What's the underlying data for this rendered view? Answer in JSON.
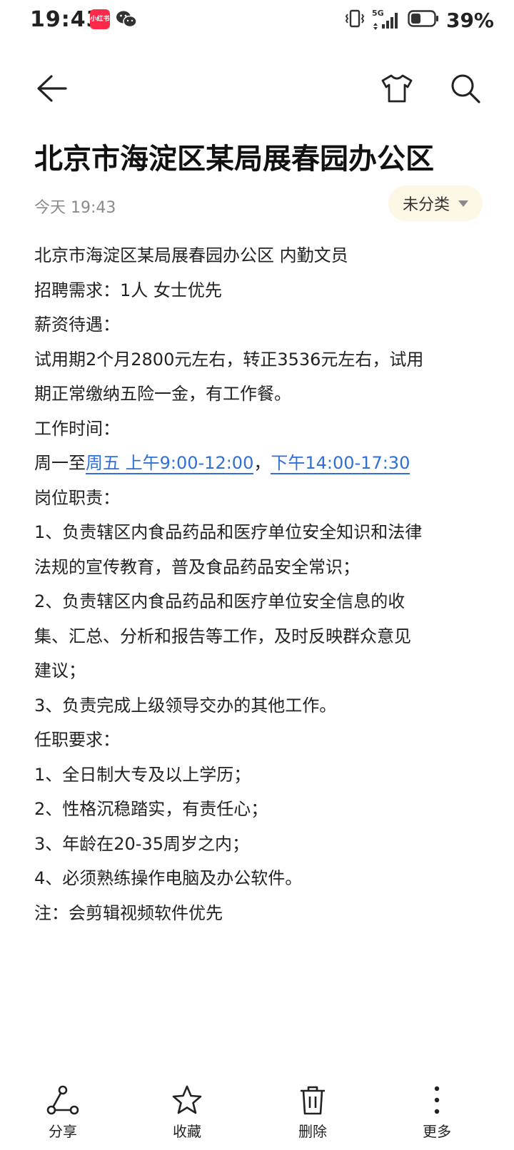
{
  "status_bar": {
    "time": "19:43",
    "app_badge": "小红书",
    "network": "5G",
    "battery": "39%"
  },
  "toolbar": {
    "back_icon": "arrow-left-icon",
    "theme_icon": "tshirt-icon",
    "search_icon": "search-icon"
  },
  "note": {
    "title": "北京市海淀区某局展春园办公区",
    "date": "今天 19:43",
    "category": "未分类",
    "lines": {
      "l1": "北京市海淀区某局展春园办公区  内勤文员",
      "l2": "招聘需求：1人   女士优先",
      "l3": "薪资待遇：",
      "l4": "试用期2个月2800元左右，转正3536元左右，试用",
      "l5": "期正常缴纳五险一金，有工作餐。",
      "l6": "工作时间：",
      "l7_prefix": "周一至",
      "l7_link1": "周五 上午9:00-12:00",
      "l7_sep": "，",
      "l7_link2": "下午14:00-17:30",
      "l8": "岗位职责：",
      "l9": "1、负责辖区内食品药品和医疗单位安全知识和法律",
      "l10": "法规的宣传教育，普及食品药品安全常识；",
      "l11": "2、负责辖区内食品药品和医疗单位安全信息的收",
      "l12": "集、汇总、分析和报告等工作，及时反映群众意见",
      "l13": "建议；",
      "l14": "3、负责完成上级领导交办的其他工作。",
      "l15": "任职要求：",
      "l16": "1、全日制大专及以上学历；",
      "l17": "2、性格沉稳踏实，有责任心；",
      "l18": "3、年龄在20-35周岁之内；",
      "l19": "4、必须熟练操作电脑及办公软件。",
      "l20": "注：会剪辑视频软件优先"
    }
  },
  "bottom_bar": {
    "share": "分享",
    "favorite": "收藏",
    "delete": "删除",
    "more": "更多"
  },
  "colors": {
    "link": "#2f6fd6",
    "chip_bg": "#fdf7e6",
    "badge": "#ff2a4a"
  }
}
